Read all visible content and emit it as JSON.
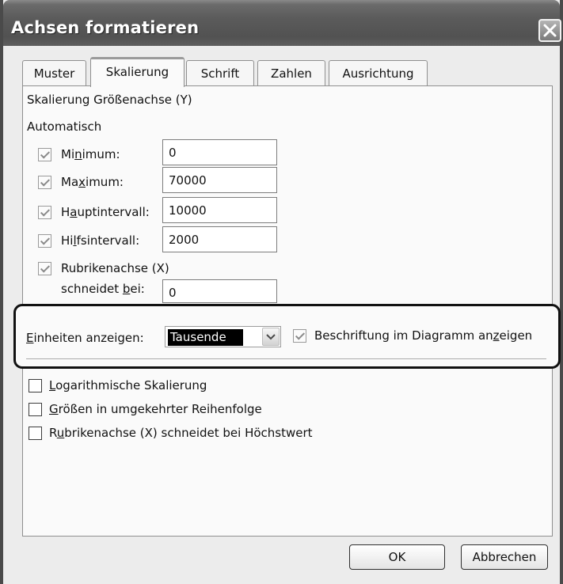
{
  "dialog": {
    "title": "Achsen formatieren"
  },
  "tabs": [
    {
      "label": "Muster"
    },
    {
      "label": "Skalierung"
    },
    {
      "label": "Schrift"
    },
    {
      "label": "Zahlen"
    },
    {
      "label": "Ausrichtung"
    }
  ],
  "active_tab": "Skalierung",
  "scaling": {
    "section_title": "Skalierung Größenachse (Y)",
    "auto_header": "Automatisch",
    "minimum": {
      "pre": "Mi",
      "key": "n",
      "post": "imum:",
      "value": "0",
      "auto": true
    },
    "maximum": {
      "pre": "Ma",
      "key": "x",
      "post": "imum:",
      "value": "70000",
      "auto": true
    },
    "major_unit": {
      "pre": "H",
      "key": "a",
      "post": "uptintervall:",
      "value": "10000",
      "auto": true
    },
    "minor_unit": {
      "pre": "Hi",
      "key": "l",
      "post": "fsintervall:",
      "value": "2000",
      "auto": true
    },
    "crosses": {
      "label": "Rubrikenachse (X)",
      "sub_pre": "schneidet ",
      "sub_key": "b",
      "sub_post": "ei:",
      "value": "0",
      "auto": true
    }
  },
  "display_units": {
    "label_key": "E",
    "label_rest": "inheiten anzeigen:",
    "selected": "Tausende",
    "show_label_pre": "Beschriftung im Diagramm an",
    "show_label_key": "z",
    "show_label_post": "eigen",
    "show_label_checked": true
  },
  "options": [
    {
      "pre": "",
      "key": "L",
      "post": "ogarithmische Skalierung",
      "checked": false
    },
    {
      "pre": "",
      "key": "G",
      "post": "rößen in umgekehrter Reihenfolge",
      "checked": false
    },
    {
      "pre": "R",
      "key": "u",
      "post": "brikenachse (X) schneidet bei Höchstwert",
      "checked": false
    }
  ],
  "buttons": {
    "ok": "OK",
    "cancel": "Abbrechen"
  },
  "colors": {
    "title_bar": "#5b5b5b",
    "dialog_bg": "#ececec",
    "panel_bg": "#fafafa",
    "selection_bg": "#000000"
  }
}
